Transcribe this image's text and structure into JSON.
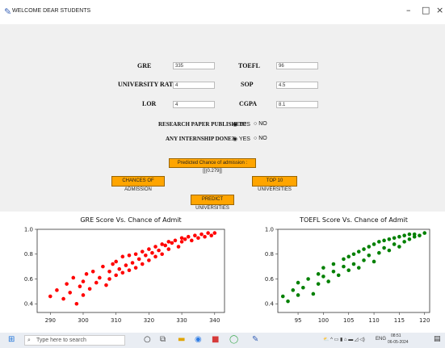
{
  "window": {
    "title": "WELCOME DEAR STUDENTS",
    "minimize": "–",
    "maximize": "□",
    "close": "×"
  },
  "form": {
    "gre_label": "GRE",
    "gre_value": "335",
    "toefl_label": "TOEFL",
    "toefl_value": "96",
    "rating_label": "UNIVERSITY RATING",
    "rating_value": "4",
    "sop_label": "SOP",
    "sop_value": "4.5",
    "lor_label": "LOR",
    "lor_value": "4",
    "cgpa_label": "CGPA",
    "cgpa_value": "8.1",
    "research_label": "RESEARCH PAPER PUBLISHED?",
    "internship_label": "ANY INTERNSHIP DONE?",
    "yes": "YES",
    "no": "NO",
    "result_text": "Predicted Chance of admission : [[(0.279]]",
    "chances_button": "CHANCES OF ADMISSION",
    "top10_button": "TOP 10 UNIVERSITIES",
    "predict_button": "PREDICT UNIVERSITIES"
  },
  "chart_data": [
    {
      "type": "scatter",
      "title": "GRE Score Vs. Chance of Admit",
      "color": "#ff0000",
      "xticks": [
        290,
        300,
        310,
        320,
        330,
        340
      ],
      "yticks": [
        0.4,
        0.6,
        0.8,
        1.0
      ],
      "xlim": [
        286,
        343
      ],
      "ylim": [
        0.33,
        1.0
      ],
      "x": [
        290,
        292,
        294,
        295,
        296,
        297,
        298,
        299,
        300,
        300,
        301,
        302,
        303,
        304,
        305,
        306,
        307,
        308,
        308,
        309,
        310,
        310,
        311,
        312,
        312,
        313,
        314,
        314,
        315,
        316,
        316,
        317,
        318,
        318,
        319,
        320,
        320,
        321,
        322,
        322,
        323,
        324,
        324,
        325,
        326,
        326,
        327,
        328,
        329,
        330,
        330,
        331,
        332,
        333,
        334,
        335,
        336,
        337,
        338,
        339,
        340
      ],
      "y": [
        0.46,
        0.51,
        0.44,
        0.56,
        0.49,
        0.61,
        0.4,
        0.54,
        0.58,
        0.47,
        0.64,
        0.52,
        0.66,
        0.57,
        0.61,
        0.7,
        0.55,
        0.66,
        0.6,
        0.72,
        0.63,
        0.74,
        0.68,
        0.65,
        0.78,
        0.71,
        0.67,
        0.79,
        0.73,
        0.8,
        0.69,
        0.76,
        0.82,
        0.72,
        0.79,
        0.84,
        0.75,
        0.81,
        0.86,
        0.78,
        0.83,
        0.88,
        0.8,
        0.87,
        0.9,
        0.84,
        0.89,
        0.91,
        0.86,
        0.93,
        0.9,
        0.92,
        0.94,
        0.91,
        0.95,
        0.93,
        0.96,
        0.94,
        0.97,
        0.95,
        0.97
      ]
    },
    {
      "type": "scatter",
      "title": "TOEFL Score Vs. Chance of Admit",
      "color": "#008000",
      "xticks": [
        95,
        100,
        105,
        110,
        115,
        120
      ],
      "yticks": [
        0.4,
        0.6,
        0.8,
        1.0
      ],
      "xlim": [
        91,
        121
      ],
      "ylim": [
        0.33,
        1.0
      ],
      "x": [
        92,
        93,
        94,
        95,
        95,
        96,
        97,
        98,
        99,
        99,
        100,
        100,
        101,
        102,
        102,
        103,
        104,
        104,
        105,
        105,
        106,
        106,
        107,
        107,
        108,
        108,
        109,
        109,
        110,
        110,
        111,
        111,
        112,
        112,
        113,
        113,
        114,
        114,
        115,
        115,
        116,
        116,
        117,
        117,
        118,
        118,
        119,
        120
      ],
      "y": [
        0.46,
        0.42,
        0.51,
        0.47,
        0.57,
        0.53,
        0.6,
        0.48,
        0.64,
        0.56,
        0.62,
        0.69,
        0.58,
        0.66,
        0.72,
        0.63,
        0.7,
        0.76,
        0.67,
        0.78,
        0.72,
        0.8,
        0.69,
        0.82,
        0.75,
        0.84,
        0.79,
        0.86,
        0.74,
        0.88,
        0.81,
        0.9,
        0.85,
        0.91,
        0.83,
        0.92,
        0.88,
        0.93,
        0.86,
        0.94,
        0.9,
        0.95,
        0.92,
        0.96,
        0.94,
        0.96,
        0.95,
        0.97
      ]
    }
  ],
  "taskbar": {
    "search_placeholder": "Type here to search",
    "lang": "ENG",
    "time": "08:51",
    "date": "06-05-2024"
  }
}
